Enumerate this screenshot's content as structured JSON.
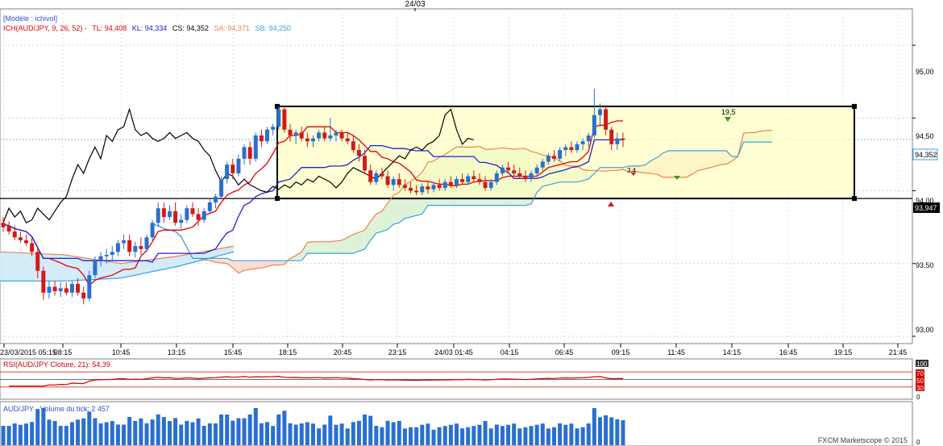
{
  "header": {
    "date_label": "24/03"
  },
  "legend": {
    "model": "[Modèle : ichivol]",
    "ich": "ICH(AUD/JPY, 9, 26, 52) -",
    "tl": "TL: 94,408",
    "kl": "KL: 94,334",
    "cs": "CS: 94,352",
    "sa": "SA: 94,371",
    "sb": "SB: 94,250"
  },
  "price_panel": {
    "y_ticks": [
      "95,00",
      "94,50",
      "94,00",
      "93,50",
      "93,00"
    ],
    "current_price_label": "94,352",
    "hline_label": "93,947",
    "annotation_top": "19,5",
    "annotation_mid": "3,4"
  },
  "x_axis": {
    "ticks": [
      "23/03/2015 05:15",
      "08:15",
      "10:45",
      "13:15",
      "15:45",
      "18:15",
      "20:45",
      "23:15",
      "24/03 01:45",
      "04:15",
      "06:45",
      "09:15",
      "11:45",
      "14:15",
      "16:45",
      "19:15",
      "21:45"
    ]
  },
  "rsi_panel": {
    "title": "RSI(AUD/JPY Cloture, 21): 54,39",
    "levels": [
      "100",
      "70",
      "50",
      "30",
      "0"
    ]
  },
  "volume_panel": {
    "title": "AUD/JPY - Volume du tick: 2 457",
    "zero_label": "0",
    "watermark": "FXCM Marketscope © 2015"
  },
  "colors": {
    "bull": "#2a6fd0",
    "bear": "#d11a1a",
    "tenkan": "#e00000",
    "kijun": "#2020d0",
    "chikou": "#000000",
    "senkou_a": "#f08050",
    "senkou_b": "#3aa0e0",
    "box_fill": "#ffffc0",
    "rsi": "#d00000",
    "volume": "#2a6fd0"
  },
  "chart_data": {
    "type": "candlestick",
    "y_range": [
      92.95,
      95.25
    ],
    "x_range": [
      "23/03/2015 04:00",
      "24/03/2015 22:30"
    ],
    "candles": [
      {
        "o": 93.78,
        "h": 93.82,
        "l": 93.72,
        "c": 93.75
      },
      {
        "o": 93.76,
        "h": 93.79,
        "l": 93.7,
        "c": 93.72
      },
      {
        "o": 93.72,
        "h": 93.76,
        "l": 93.66,
        "c": 93.68
      },
      {
        "o": 93.68,
        "h": 93.72,
        "l": 93.64,
        "c": 93.66
      },
      {
        "o": 93.66,
        "h": 93.7,
        "l": 93.62,
        "c": 93.64
      },
      {
        "o": 93.64,
        "h": 93.68,
        "l": 93.55,
        "c": 93.58
      },
      {
        "o": 93.58,
        "h": 93.62,
        "l": 93.4,
        "c": 93.45
      },
      {
        "o": 93.45,
        "h": 93.48,
        "l": 93.25,
        "c": 93.3
      },
      {
        "o": 93.3,
        "h": 93.38,
        "l": 93.26,
        "c": 93.34
      },
      {
        "o": 93.34,
        "h": 93.38,
        "l": 93.28,
        "c": 93.31
      },
      {
        "o": 93.31,
        "h": 93.37,
        "l": 93.27,
        "c": 93.33
      },
      {
        "o": 93.33,
        "h": 93.37,
        "l": 93.28,
        "c": 93.3
      },
      {
        "o": 93.3,
        "h": 93.38,
        "l": 93.27,
        "c": 93.36
      },
      {
        "o": 93.36,
        "h": 93.4,
        "l": 93.28,
        "c": 93.3
      },
      {
        "o": 93.3,
        "h": 93.34,
        "l": 93.22,
        "c": 93.26
      },
      {
        "o": 93.26,
        "h": 93.45,
        "l": 93.24,
        "c": 93.42
      },
      {
        "o": 93.42,
        "h": 93.55,
        "l": 93.4,
        "c": 93.52
      },
      {
        "o": 93.52,
        "h": 93.58,
        "l": 93.48,
        "c": 93.55
      },
      {
        "o": 93.55,
        "h": 93.6,
        "l": 93.5,
        "c": 93.56
      },
      {
        "o": 93.56,
        "h": 93.62,
        "l": 93.52,
        "c": 93.58
      },
      {
        "o": 93.58,
        "h": 93.66,
        "l": 93.55,
        "c": 93.64
      },
      {
        "o": 93.64,
        "h": 93.7,
        "l": 93.6,
        "c": 93.66
      },
      {
        "o": 93.66,
        "h": 93.7,
        "l": 93.55,
        "c": 93.58
      },
      {
        "o": 93.58,
        "h": 93.65,
        "l": 93.54,
        "c": 93.62
      },
      {
        "o": 93.62,
        "h": 93.68,
        "l": 93.56,
        "c": 93.6
      },
      {
        "o": 93.6,
        "h": 93.7,
        "l": 93.58,
        "c": 93.68
      },
      {
        "o": 93.68,
        "h": 93.8,
        "l": 93.66,
        "c": 93.78
      },
      {
        "o": 93.78,
        "h": 93.92,
        "l": 93.75,
        "c": 93.88
      },
      {
        "o": 93.88,
        "h": 93.92,
        "l": 93.78,
        "c": 93.82
      },
      {
        "o": 93.82,
        "h": 93.9,
        "l": 93.8,
        "c": 93.86
      },
      {
        "o": 93.86,
        "h": 93.92,
        "l": 93.76,
        "c": 93.78
      },
      {
        "o": 93.78,
        "h": 93.84,
        "l": 93.74,
        "c": 93.8
      },
      {
        "o": 93.8,
        "h": 93.9,
        "l": 93.78,
        "c": 93.88
      },
      {
        "o": 93.88,
        "h": 93.92,
        "l": 93.82,
        "c": 93.84
      },
      {
        "o": 93.84,
        "h": 93.88,
        "l": 93.76,
        "c": 93.8
      },
      {
        "o": 93.8,
        "h": 93.88,
        "l": 93.78,
        "c": 93.86
      },
      {
        "o": 93.86,
        "h": 93.95,
        "l": 93.84,
        "c": 93.92
      },
      {
        "o": 93.92,
        "h": 93.98,
        "l": 93.88,
        "c": 93.96
      },
      {
        "o": 93.96,
        "h": 94.1,
        "l": 93.94,
        "c": 94.08
      },
      {
        "o": 94.08,
        "h": 94.2,
        "l": 94.05,
        "c": 94.18
      },
      {
        "o": 94.18,
        "h": 94.22,
        "l": 94.08,
        "c": 94.12
      },
      {
        "o": 94.12,
        "h": 94.25,
        "l": 94.1,
        "c": 94.22
      },
      {
        "o": 94.22,
        "h": 94.32,
        "l": 94.18,
        "c": 94.3
      },
      {
        "o": 94.3,
        "h": 94.34,
        "l": 94.18,
        "c": 94.22
      },
      {
        "o": 94.22,
        "h": 94.4,
        "l": 94.2,
        "c": 94.38
      },
      {
        "o": 94.38,
        "h": 94.42,
        "l": 94.3,
        "c": 94.34
      },
      {
        "o": 94.34,
        "h": 94.44,
        "l": 94.32,
        "c": 94.42
      },
      {
        "o": 94.42,
        "h": 94.46,
        "l": 94.38,
        "c": 94.44
      },
      {
        "o": 94.44,
        "h": 94.58,
        "l": 94.42,
        "c": 94.56
      },
      {
        "o": 94.56,
        "h": 94.58,
        "l": 94.4,
        "c": 94.42
      },
      {
        "o": 94.42,
        "h": 94.46,
        "l": 94.34,
        "c": 94.38
      },
      {
        "o": 94.38,
        "h": 94.42,
        "l": 94.32,
        "c": 94.4
      },
      {
        "o": 94.4,
        "h": 94.44,
        "l": 94.34,
        "c": 94.36
      },
      {
        "o": 94.36,
        "h": 94.4,
        "l": 94.3,
        "c": 94.34
      },
      {
        "o": 94.34,
        "h": 94.38,
        "l": 94.3,
        "c": 94.36
      },
      {
        "o": 94.36,
        "h": 94.42,
        "l": 94.34,
        "c": 94.4
      },
      {
        "o": 94.4,
        "h": 94.44,
        "l": 94.34,
        "c": 94.36
      },
      {
        "o": 94.36,
        "h": 94.5,
        "l": 94.34,
        "c": 94.38
      },
      {
        "o": 94.38,
        "h": 94.42,
        "l": 94.34,
        "c": 94.4
      },
      {
        "o": 94.4,
        "h": 94.42,
        "l": 94.34,
        "c": 94.36
      },
      {
        "o": 94.36,
        "h": 94.4,
        "l": 94.32,
        "c": 94.34
      },
      {
        "o": 94.34,
        "h": 94.38,
        "l": 94.26,
        "c": 94.28
      },
      {
        "o": 94.28,
        "h": 94.32,
        "l": 94.2,
        "c": 94.24
      },
      {
        "o": 94.24,
        "h": 94.28,
        "l": 94.12,
        "c": 94.14
      },
      {
        "o": 94.14,
        "h": 94.18,
        "l": 94.04,
        "c": 94.06
      },
      {
        "o": 94.06,
        "h": 94.14,
        "l": 94.04,
        "c": 94.12
      },
      {
        "o": 94.12,
        "h": 94.16,
        "l": 94.08,
        "c": 94.1
      },
      {
        "o": 94.1,
        "h": 94.14,
        "l": 94.02,
        "c": 94.04
      },
      {
        "o": 94.04,
        "h": 94.1,
        "l": 94.0,
        "c": 94.08
      },
      {
        "o": 94.08,
        "h": 94.12,
        "l": 94.02,
        "c": 94.04
      },
      {
        "o": 94.04,
        "h": 94.08,
        "l": 94.0,
        "c": 94.02
      },
      {
        "o": 94.02,
        "h": 94.06,
        "l": 93.98,
        "c": 94.0
      },
      {
        "o": 94.0,
        "h": 94.04,
        "l": 93.97,
        "c": 93.99
      },
      {
        "o": 93.99,
        "h": 94.05,
        "l": 93.97,
        "c": 94.03
      },
      {
        "o": 94.03,
        "h": 94.06,
        "l": 93.98,
        "c": 94.01
      },
      {
        "o": 94.01,
        "h": 94.06,
        "l": 93.99,
        "c": 94.04
      },
      {
        "o": 94.04,
        "h": 94.08,
        "l": 94.0,
        "c": 94.02
      },
      {
        "o": 94.02,
        "h": 94.08,
        "l": 94.0,
        "c": 94.06
      },
      {
        "o": 94.06,
        "h": 94.1,
        "l": 94.02,
        "c": 94.04
      },
      {
        "o": 94.04,
        "h": 94.1,
        "l": 94.02,
        "c": 94.08
      },
      {
        "o": 94.08,
        "h": 94.12,
        "l": 94.04,
        "c": 94.06
      },
      {
        "o": 94.06,
        "h": 94.12,
        "l": 94.04,
        "c": 94.1
      },
      {
        "o": 94.1,
        "h": 94.14,
        "l": 94.06,
        "c": 94.08
      },
      {
        "o": 94.08,
        "h": 94.12,
        "l": 94.04,
        "c": 94.06
      },
      {
        "o": 94.06,
        "h": 94.1,
        "l": 94.0,
        "c": 94.02
      },
      {
        "o": 94.02,
        "h": 94.08,
        "l": 94.0,
        "c": 94.06
      },
      {
        "o": 94.06,
        "h": 94.14,
        "l": 94.04,
        "c": 94.12
      },
      {
        "o": 94.12,
        "h": 94.18,
        "l": 94.1,
        "c": 94.16
      },
      {
        "o": 94.16,
        "h": 94.2,
        "l": 94.12,
        "c": 94.14
      },
      {
        "o": 94.14,
        "h": 94.18,
        "l": 94.1,
        "c": 94.12
      },
      {
        "o": 94.12,
        "h": 94.16,
        "l": 94.08,
        "c": 94.1
      },
      {
        "o": 94.1,
        "h": 94.14,
        "l": 94.06,
        "c": 94.08
      },
      {
        "o": 94.08,
        "h": 94.14,
        "l": 94.06,
        "c": 94.12
      },
      {
        "o": 94.12,
        "h": 94.18,
        "l": 94.1,
        "c": 94.16
      },
      {
        "o": 94.16,
        "h": 94.22,
        "l": 94.14,
        "c": 94.2
      },
      {
        "o": 94.2,
        "h": 94.26,
        "l": 94.18,
        "c": 94.24
      },
      {
        "o": 94.24,
        "h": 94.28,
        "l": 94.2,
        "c": 94.22
      },
      {
        "o": 94.22,
        "h": 94.3,
        "l": 94.2,
        "c": 94.28
      },
      {
        "o": 94.28,
        "h": 94.32,
        "l": 94.24,
        "c": 94.3
      },
      {
        "o": 94.3,
        "h": 94.34,
        "l": 94.26,
        "c": 94.28
      },
      {
        "o": 94.28,
        "h": 94.34,
        "l": 94.26,
        "c": 94.32
      },
      {
        "o": 94.32,
        "h": 94.36,
        "l": 94.28,
        "c": 94.34
      },
      {
        "o": 94.34,
        "h": 94.4,
        "l": 94.3,
        "c": 94.38
      },
      {
        "o": 94.38,
        "h": 94.7,
        "l": 94.36,
        "c": 94.52
      },
      {
        "o": 94.52,
        "h": 94.6,
        "l": 94.44,
        "c": 94.56
      },
      {
        "o": 94.56,
        "h": 94.58,
        "l": 94.38,
        "c": 94.42
      },
      {
        "o": 94.42,
        "h": 94.44,
        "l": 94.28,
        "c": 94.32
      },
      {
        "o": 94.32,
        "h": 94.4,
        "l": 94.28,
        "c": 94.36
      },
      {
        "o": 94.36,
        "h": 94.4,
        "l": 94.3,
        "c": 94.35
      }
    ],
    "box": {
      "start": "23/03 18:15",
      "end": "24/03 19:45",
      "top": 94.58,
      "bottom": 93.947
    },
    "horizontal_line": 93.947,
    "rsi": {
      "value": 54.39,
      "levels": [
        70,
        50,
        30
      ]
    },
    "volume_last": 2457
  }
}
